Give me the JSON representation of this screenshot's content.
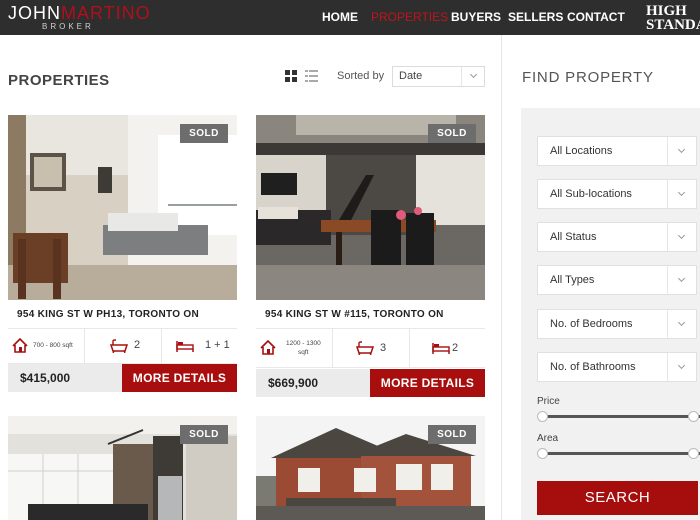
{
  "header": {
    "logo_first": "JOHN",
    "logo_last": "MARTINO",
    "logo_sub": "BROKER",
    "nav": [
      "HOME",
      "PROPERTIES",
      "BUYERS",
      "SELLERS",
      "CONTACT"
    ],
    "active_nav": "PROPERTIES",
    "brand_right_line1": "HIGH",
    "brand_right_line2": "STANDA"
  },
  "listing": {
    "title": "PROPERTIES",
    "sorted_label": "Sorted by",
    "sort_value": "Date",
    "view_icons": [
      "grid-view-icon",
      "list-view-icon"
    ]
  },
  "cards": [
    {
      "badge": "SOLD",
      "address": "954 KING ST W PH13, TORONTO ON",
      "sqft": "700 - 800 sqft",
      "baths": "2",
      "beds": "1 + 1",
      "price": "$415,000",
      "button": "MORE DETAILS"
    },
    {
      "badge": "SOLD",
      "address": "954 KING ST W #115, TORONTO ON",
      "sqft_line1": "1200 - 1300",
      "sqft_line2": "sqft",
      "baths": "3",
      "beds": "2",
      "price": "$669,900",
      "button": "MORE DETAILS"
    },
    {
      "badge": "SOLD"
    },
    {
      "badge": "SOLD"
    }
  ],
  "search": {
    "title": "FIND PROPERTY",
    "selects": [
      "All Locations",
      "All Sub-locations",
      "All Status",
      "All Types",
      "No. of Bedrooms",
      "No. of Bathrooms"
    ],
    "price_label": "Price",
    "area_label": "Area",
    "button": "SEARCH"
  },
  "colors": {
    "accent": "#a80e0e",
    "topbar": "#2e2e2e",
    "nav_active": "#c0141c"
  }
}
